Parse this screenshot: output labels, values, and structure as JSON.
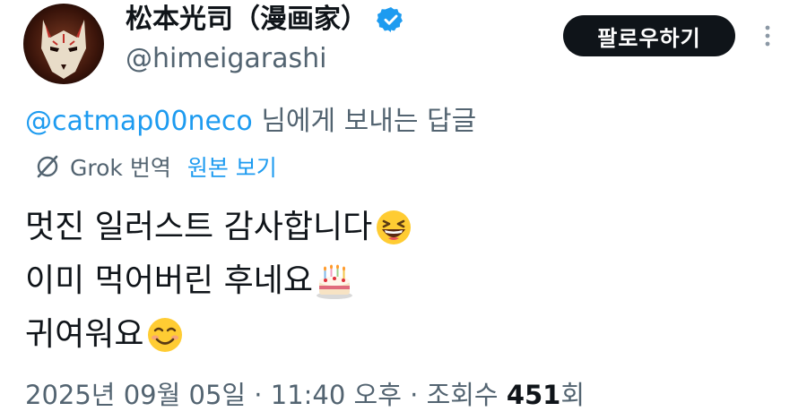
{
  "author": {
    "display_name": "松本光司（漫画家）",
    "handle": "@himeigarashi"
  },
  "header": {
    "follow_label": "팔로우하기"
  },
  "reply": {
    "mention": "@catmap00neco",
    "suffix": " 님에게 보내는 답글"
  },
  "translation": {
    "grok_label": "Grok 번역",
    "view_original_label": "원본 보기"
  },
  "tweet": {
    "lines": [
      {
        "text": "멋진 일러스트 감사합니다",
        "emoji": "grinning-squinting-face"
      },
      {
        "text": "이미 먹어버린 후네요",
        "emoji": "birthday-cake"
      },
      {
        "text": "귀여워요",
        "emoji": "smiling-face"
      }
    ]
  },
  "meta": {
    "date": "2025년 09월 05일",
    "sep1": " · ",
    "time": "11:40 오후",
    "sep2": " · ",
    "views_label": "조회수 ",
    "views_count": "451",
    "views_suffix": "회"
  },
  "colors": {
    "link": "#1d9bf0",
    "secondary_text": "#536471",
    "primary_text": "#0f1419",
    "button_bg": "#0f1419"
  }
}
